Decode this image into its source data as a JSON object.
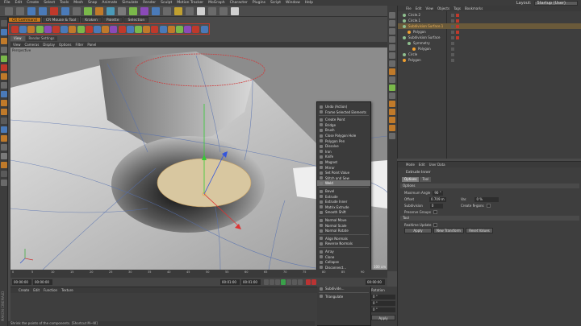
{
  "menubar": {
    "items": [
      "File",
      "Edit",
      "Create",
      "Select",
      "Tools",
      "Mesh",
      "Snap",
      "Animate",
      "Simulate",
      "Render",
      "Sculpt",
      "Motion Tracker",
      "MoGraph",
      "Character",
      "Plugins",
      "Script",
      "Window",
      "Help"
    ],
    "layout_label": "Layout:",
    "layout_value": "Startup (User)"
  },
  "tabs": [
    "CR Command",
    "CR Mouse & Tool",
    "Kraken",
    "Palette",
    "Selection"
  ],
  "viewport": {
    "tabs": [
      "View",
      "Render Settings"
    ],
    "menu": [
      "View",
      "Cameras",
      "Display",
      "Options",
      "Filter",
      "Panel"
    ],
    "label": "Perspective",
    "corner": "Grid Spacing : 100 cm"
  },
  "context_menu": {
    "items": [
      {
        "label": "Undo (Action)"
      },
      {
        "label": "Frame Selected Elements"
      },
      {
        "sep": true
      },
      {
        "label": "Create Point"
      },
      {
        "label": "Bridge"
      },
      {
        "label": "Brush"
      },
      {
        "label": "Close Polygon Hole"
      },
      {
        "label": "Polygon Pen"
      },
      {
        "label": "Dissolve"
      },
      {
        "label": "Iron"
      },
      {
        "label": "Knife"
      },
      {
        "label": "Magnet"
      },
      {
        "label": "Mirror"
      },
      {
        "label": "Set Point Value"
      },
      {
        "label": "Stitch and Sew"
      },
      {
        "label": "Weld",
        "highlight": true
      },
      {
        "sep": true
      },
      {
        "label": "Bevel"
      },
      {
        "label": "Extrude"
      },
      {
        "label": "Extrude Inner"
      },
      {
        "label": "Matrix Extrude"
      },
      {
        "label": "Smooth Shift"
      },
      {
        "sep": true
      },
      {
        "label": "Normal Move"
      },
      {
        "label": "Normal Scale"
      },
      {
        "label": "Normal Rotate"
      },
      {
        "sep": true
      },
      {
        "label": "Align Normals"
      },
      {
        "label": "Reverse Normals"
      },
      {
        "sep": true
      },
      {
        "label": "Array"
      },
      {
        "label": "Clone"
      },
      {
        "label": "Collapse"
      },
      {
        "label": "Disconnect..."
      },
      {
        "label": "Melt"
      },
      {
        "label": "Optimize..."
      },
      {
        "label": "Split"
      },
      {
        "label": "Subdivide..."
      },
      {
        "sep": true
      },
      {
        "label": "Triangulate"
      }
    ]
  },
  "object_manager": {
    "menu": [
      "File",
      "Edit",
      "View",
      "Objects",
      "Tags",
      "Bookmarks"
    ],
    "rows": [
      {
        "label": "Circle.2",
        "indent": 0,
        "color": "#8fbf8f",
        "selected": false
      },
      {
        "label": "Circle.1",
        "indent": 0,
        "color": "#8fbf8f",
        "selected": false
      },
      {
        "label": "Subdivision Surface.1",
        "indent": 0,
        "color": "#8fbf8f",
        "selected": true
      },
      {
        "label": "Polygon",
        "indent": 1,
        "color": "#f0a030",
        "selected": false
      },
      {
        "label": "Subdivision Surface",
        "indent": 0,
        "color": "#8fbf8f",
        "selected": false
      },
      {
        "label": "Symmetry",
        "indent": 1,
        "color": "#8fbf8f",
        "selected": false
      },
      {
        "label": "Polygon",
        "indent": 2,
        "color": "#f0a030",
        "selected": false
      },
      {
        "label": "Circle",
        "indent": 0,
        "color": "#8fbf8f",
        "selected": false
      },
      {
        "label": "Polygon",
        "indent": 0,
        "color": "#f0a030",
        "selected": false
      }
    ]
  },
  "attribute_manager": {
    "menu": [
      "Mode",
      "Edit",
      "User Data"
    ],
    "title": "Extrude Inner",
    "tabs": [
      "Options",
      "Tool"
    ],
    "options_header": "Options",
    "max_angle_label": "Maximum Angle",
    "max_angle_value": "90 °",
    "offset_label": "Offset",
    "offset_value": "0.709 m",
    "var_label": "Var.",
    "var_value": "0 %",
    "subdivision_label": "Subdivision",
    "subdivision_value": "0",
    "create_ngons_label": "Create N-gons",
    "preserve_groups_label": "Preserve Groups",
    "tool_header": "Tool",
    "realtime_label": "Realtime Update",
    "apply_label": "Apply",
    "new_transform_label": "New Transform",
    "reset_values_label": "Reset Values"
  },
  "timeline": {
    "ticks": [
      "0",
      "5",
      "10",
      "15",
      "20",
      "25",
      "30",
      "35",
      "40",
      "45",
      "50",
      "55",
      "60",
      "65",
      "70",
      "75",
      "80",
      "85",
      "90"
    ],
    "start": "00:00:00",
    "current": "00:00:00",
    "end": "00:01:00",
    "end2": "00:01:00",
    "right_field": "00:00:00"
  },
  "material_manager": {
    "menu": [
      "Create",
      "Edit",
      "Function",
      "Texture"
    ]
  },
  "coordinates": {
    "rotation_label": "Rotation",
    "h": "0 °",
    "p": "0 °",
    "b": "0 °",
    "apply": "Apply"
  },
  "status": "Shrink the points of the components. [Shortcut M~W]",
  "brand": "MAXON CINEMA4D"
}
